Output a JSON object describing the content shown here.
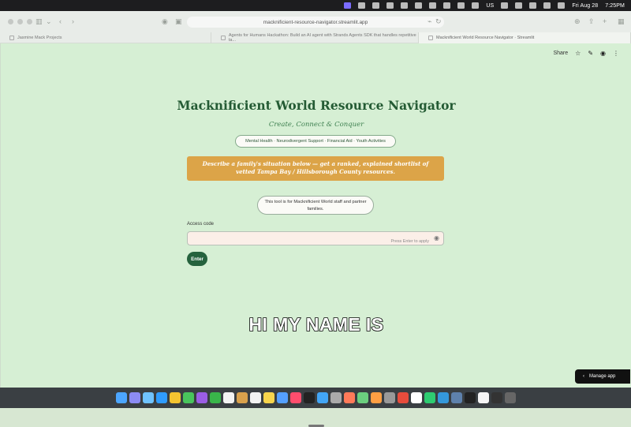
{
  "menubar": {
    "date": "Fri Aug 28",
    "time": "7:25PM",
    "status_text": "US"
  },
  "browser": {
    "url": "macknificient-resource-navigator.streamlit.app",
    "tabs": [
      {
        "label": "Jasmine Mack Projects"
      },
      {
        "label": "Agents for Humans Hackathon: Build an AI agent with Strands Agents SDK that handles repetitive ta..."
      },
      {
        "label": "Macknificient World Resource Navigator · Streamlit"
      }
    ]
  },
  "toolbar": {
    "share_label": "Share"
  },
  "header": {
    "title": "Macknificient World Resource Navigator",
    "subtitle": "Create, Connect & Conquer",
    "categories": "Mental Health · Neurodivergent Support · Financial Aid · Youth Activities"
  },
  "banner": {
    "text": "Describe a family's situation below — get a ranked, explained shortlist of vetted Tampa Bay / Hillsborough County resources."
  },
  "notice": {
    "text": "This tool is for Macknificient World staff and partner families."
  },
  "form": {
    "label": "Access code",
    "hint": "Press Enter to apply",
    "button": "Enter",
    "value": ""
  },
  "caption": {
    "text": "HI MY NAME IS"
  },
  "manage": {
    "label": "Manage app"
  },
  "colors": {
    "page_bg": "#d6efd4",
    "accent": "#245b34",
    "banner": "#dca448",
    "button": "#25623d"
  },
  "icons": [
    "search-icon",
    "star-icon",
    "pencil-icon",
    "github-icon",
    "more-icon",
    "eye-icon",
    "chevron-left-icon"
  ]
}
